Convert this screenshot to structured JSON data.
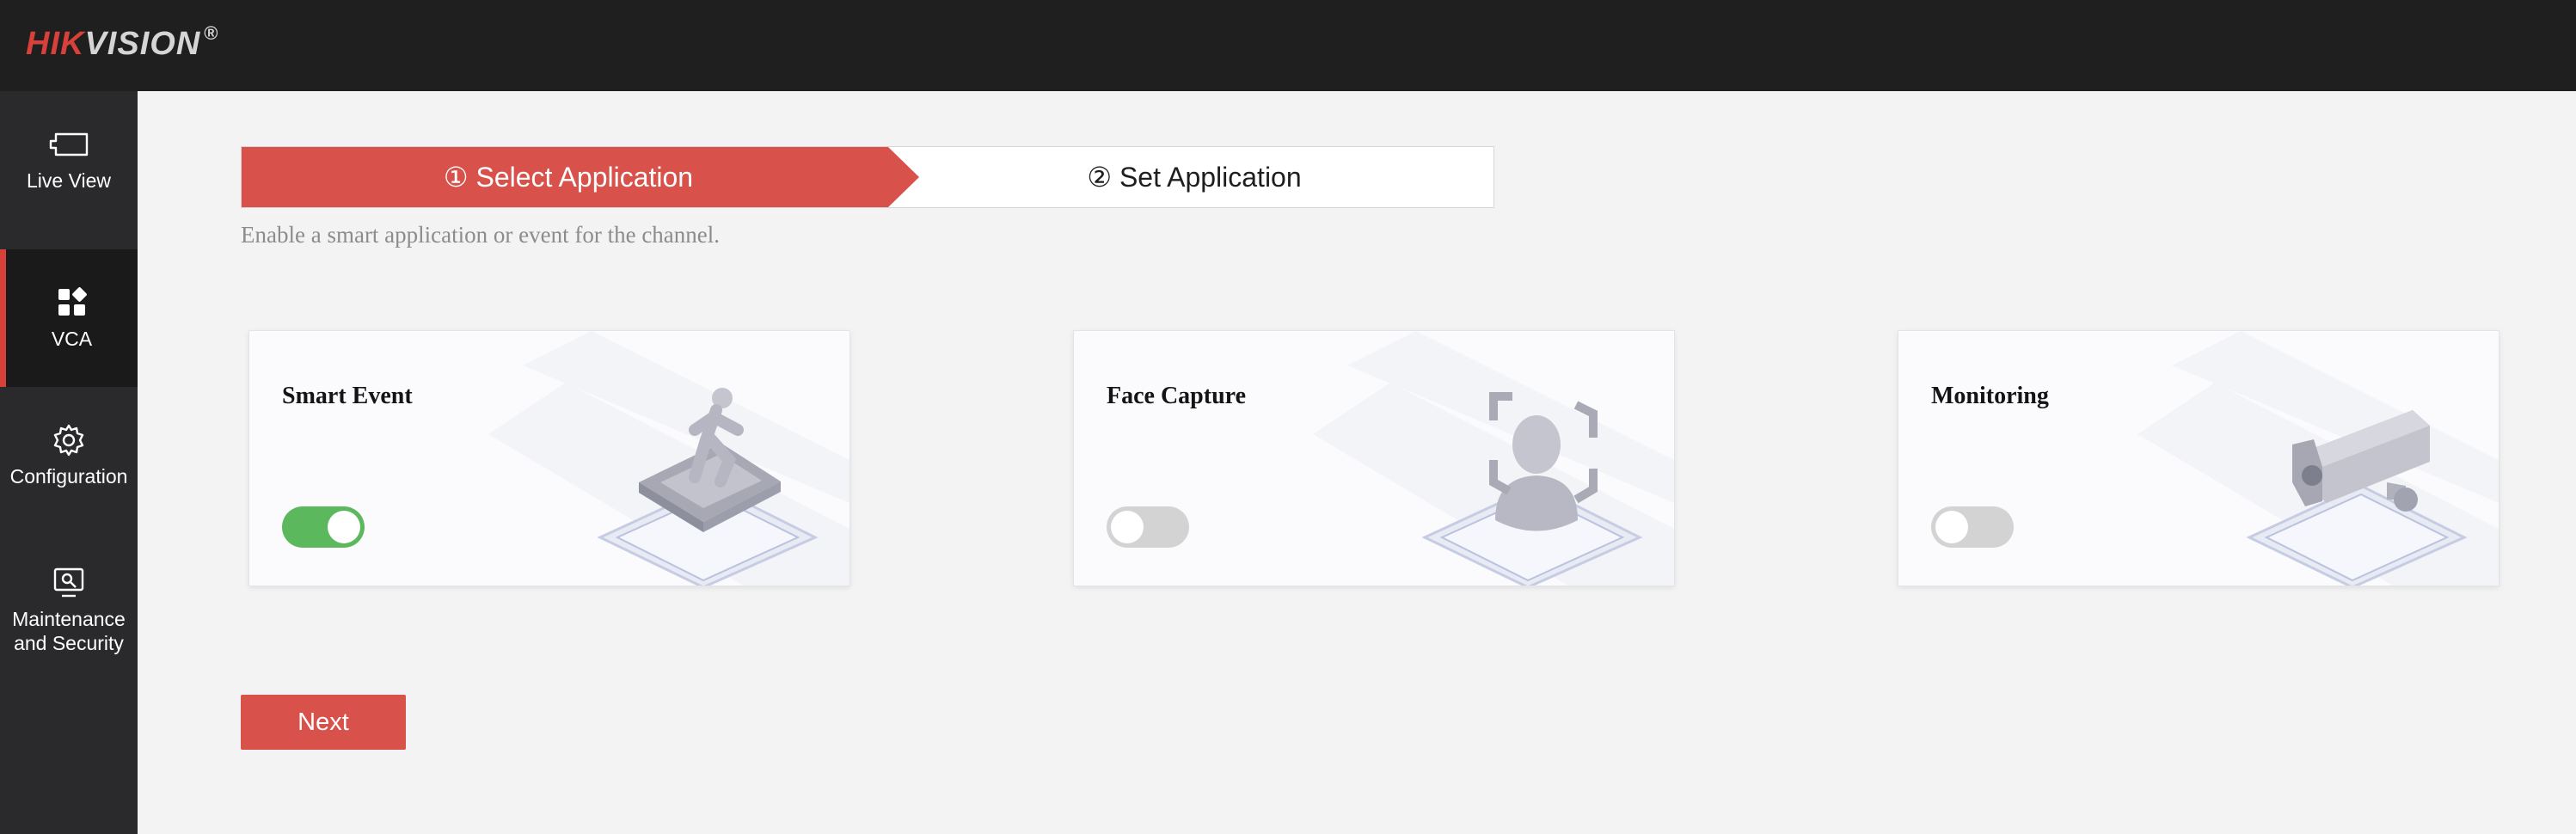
{
  "brand": {
    "logo_hik": "HIK",
    "logo_vision": "VISION",
    "logo_reg": "®",
    "accent": "#d8413a"
  },
  "sidebar": {
    "items": [
      {
        "label": "Live View",
        "icon": "monitor-icon",
        "active": false
      },
      {
        "label": "VCA",
        "icon": "apps-grid-icon",
        "active": true
      },
      {
        "label": "Configuration",
        "icon": "gear-icon",
        "active": false
      },
      {
        "label": "Maintenance and Security",
        "icon": "maintenance-icon",
        "active": false
      }
    ]
  },
  "steps": {
    "step1": "① Select Application",
    "step2": "② Set Application",
    "active_step": 1
  },
  "hint": "Enable a smart application or event for the channel.",
  "cards": [
    {
      "title": "Smart Event",
      "enabled": true,
      "icon": "walking-person-icon"
    },
    {
      "title": "Face Capture",
      "enabled": false,
      "icon": "face-scan-icon"
    },
    {
      "title": "Monitoring",
      "enabled": false,
      "icon": "camera-icon"
    }
  ],
  "next_label": "Next",
  "colors": {
    "toggle_on": "#5cb85c",
    "toggle_off": "#d3d3d3",
    "button": "#d8514a"
  }
}
